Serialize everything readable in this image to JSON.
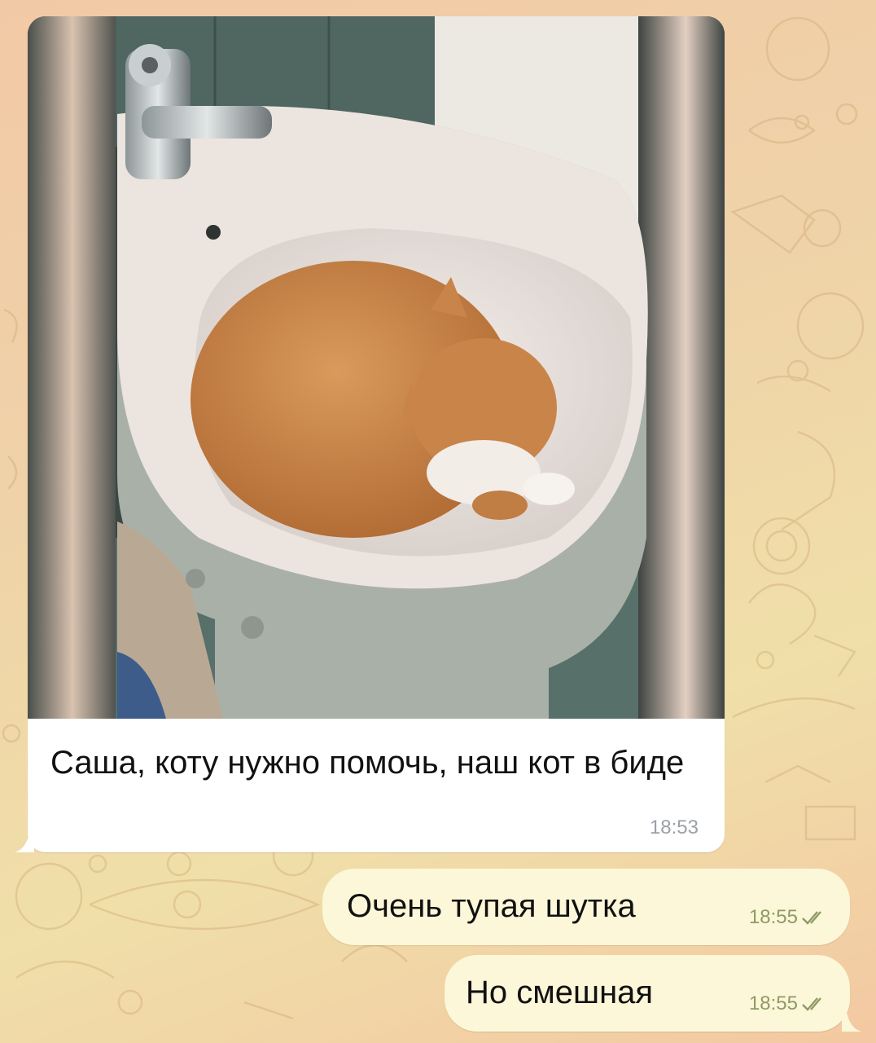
{
  "incoming": {
    "caption": "Саша, коту нужно помочь, наш кот в биде",
    "time": "18:53",
    "bubble_color": "#ffffff"
  },
  "outgoing": [
    {
      "text": "Очень тупая шутка",
      "time": "18:55",
      "status_icon": "double-check-icon"
    },
    {
      "text": "Но смешная",
      "time": "18:55",
      "status_icon": "double-check-icon"
    }
  ],
  "colors": {
    "outgoing_bubble": "#fcf7d8",
    "outgoing_meta": "#8f9a66",
    "incoming_meta": "#9aa1a8",
    "wallpaper_start": "#f2c9a6",
    "wallpaper_end": "#f0dfa9"
  }
}
